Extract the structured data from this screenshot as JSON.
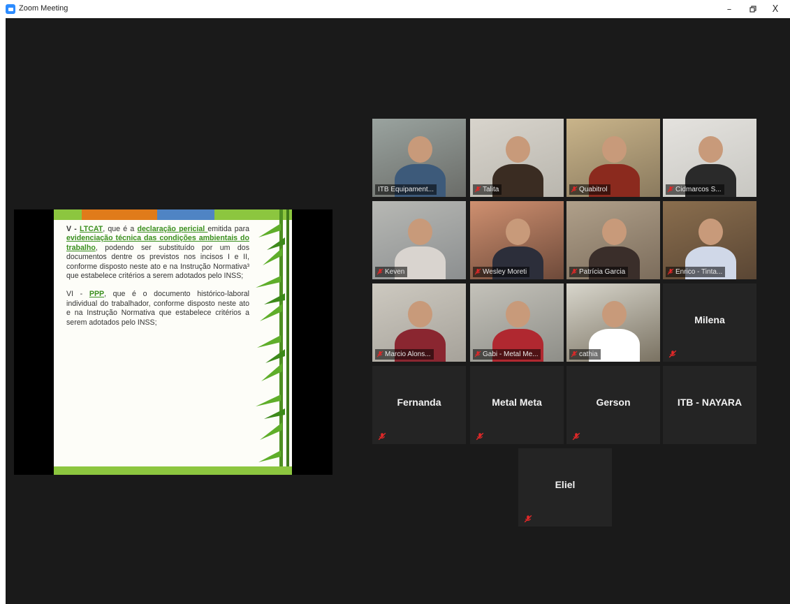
{
  "window": {
    "title": "Zoom Meeting",
    "minimize_label": "–",
    "restore_label": "ꟸ",
    "close_label": "X"
  },
  "slide": {
    "para1_prefix": "V - ",
    "para1_ltcat": "LTCAT",
    "para1_mid1": ", que é a ",
    "para1_declaracao": "declaração pericial ",
    "para1_mid2": "emitida para ",
    "para1_evidenciacao": "evidenciação técnica das condições ambientais do trabalho",
    "para1_rest": ", podendo ser substituído por um dos documentos dentre os previstos nos incisos I e II, conforme disposto neste ato e na Instrução Normativa³ que estabelece critérios a serem adotados pelo INSS;",
    "para2_prefix": "VI - ",
    "para2_ppp": "PPP",
    "para2_rest": ", que é o documento histórico-laboral individual do trabalhador, conforme disposto neste ato e na Instrução Normativa que estabelece critérios a serem adotados pelo INSS;"
  },
  "participants": [
    {
      "name": "ITB Equipament...",
      "video": true,
      "muted": false,
      "active": true
    },
    {
      "name": "Talita",
      "video": true,
      "muted": true
    },
    {
      "name": "Quabitrol",
      "video": true,
      "muted": true
    },
    {
      "name": "Cidmarcos S...",
      "video": true,
      "muted": true
    },
    {
      "name": "Keven",
      "video": true,
      "muted": true
    },
    {
      "name": "Wesley Moreti",
      "video": true,
      "muted": true
    },
    {
      "name": "Patrícia Garcia",
      "video": true,
      "muted": true
    },
    {
      "name": "Enrico - Tinta...",
      "video": true,
      "muted": true
    },
    {
      "name": "Marcio Alons...",
      "video": true,
      "muted": true
    },
    {
      "name": "Gabi - Metal Me...",
      "video": true,
      "muted": true
    },
    {
      "name": "cathia",
      "video": true,
      "muted": true
    },
    {
      "name": "Milena",
      "video": false,
      "muted": true
    },
    {
      "name": "Fernanda",
      "video": false,
      "muted": true
    },
    {
      "name": "Metal Meta",
      "video": false,
      "muted": true
    },
    {
      "name": "Gerson",
      "video": false,
      "muted": true
    },
    {
      "name": "ITB - NAYARA",
      "video": false,
      "muted": false
    },
    {
      "name": "Eliel",
      "video": false,
      "muted": true
    }
  ],
  "colors": {
    "accent_active": "#b8e04a",
    "muted_red": "#e02828",
    "slide_green": "#3a8f1e",
    "stage_bg": "#1a1a1a"
  }
}
